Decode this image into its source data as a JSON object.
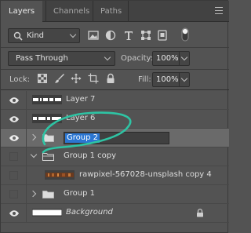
{
  "tabs": [
    {
      "label": "Layers",
      "active": true
    },
    {
      "label": "Channels",
      "active": false
    },
    {
      "label": "Paths",
      "active": false
    }
  ],
  "filter": {
    "kind_label": "Kind",
    "icons": [
      "image-filter-icon",
      "adjustment-filter-icon",
      "type-filter-icon",
      "shape-filter-icon",
      "smart-object-filter-icon",
      "filter-toggle-icon"
    ]
  },
  "blend": {
    "mode": "Pass Through",
    "opacity_label": "Opacity:",
    "opacity_value": "100%"
  },
  "lock": {
    "label": "Lock:",
    "fill_label": "Fill:",
    "fill_value": "100%",
    "icons": [
      "lock-transparent-pixels-icon",
      "lock-image-pixels-icon",
      "lock-position-icon",
      "lock-artboard-icon",
      "lock-all-icon"
    ]
  },
  "layers": [
    {
      "name": "Layer 7",
      "visible": true,
      "type": "pixel",
      "selected": false
    },
    {
      "name": "Layer 6",
      "visible": true,
      "type": "pixel",
      "selected": false
    },
    {
      "name": "Group 2",
      "visible": true,
      "type": "group-collapsed",
      "selected": true,
      "editing": true
    },
    {
      "name": "Group 1 copy",
      "visible": false,
      "type": "group-expanded",
      "selected": false
    },
    {
      "name": "rawpixel-567028-unsplash copy 4",
      "visible": false,
      "type": "pixel-child",
      "selected": false
    },
    {
      "name": "Group 1",
      "visible": false,
      "type": "group-collapsed",
      "selected": false
    },
    {
      "name": "Background",
      "visible": true,
      "type": "background",
      "selected": false,
      "locked": true
    }
  ],
  "colors": {
    "accent": "#2b76d2",
    "annotation": "#2ec4a4",
    "panel": "#535353",
    "tabbar": "#424242"
  }
}
